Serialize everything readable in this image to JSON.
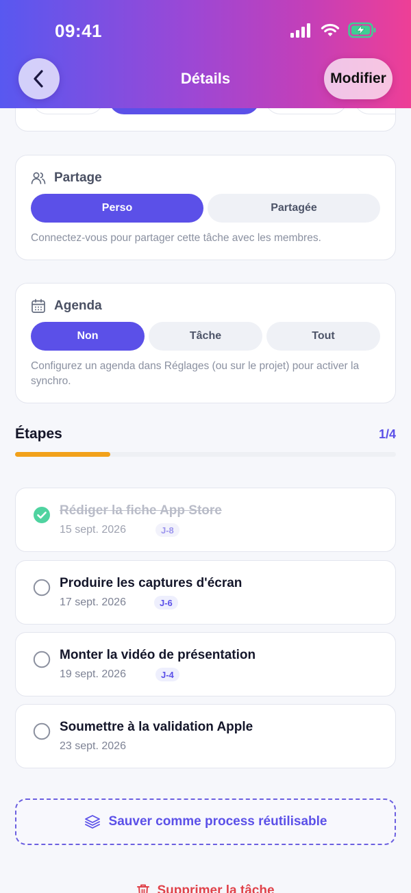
{
  "status_bar": {
    "time": "09:41"
  },
  "header": {
    "title": "Détails",
    "back_icon": "chevron-left-icon",
    "edit_label": "Modifier"
  },
  "sharing": {
    "title": "Partage",
    "options": [
      "Perso",
      "Partagée"
    ],
    "selected": "Perso",
    "hint": "Connectez-vous pour partager cette tâche avec les membres."
  },
  "calendar": {
    "title": "Agenda",
    "options": [
      "Non",
      "Tâche",
      "Tout"
    ],
    "selected": "Non",
    "hint": "Configurez un agenda dans Réglages (ou sur le projet) pour activer la synchro."
  },
  "steps": {
    "title": "Étapes",
    "count": "1/4",
    "progress": 0.25,
    "items": [
      {
        "title": "Rédiger la fiche App Store",
        "date": "15 sept. 2026",
        "badge": "J-8",
        "done": true
      },
      {
        "title": "Produire les captures d'écran",
        "date": "17 sept. 2026",
        "badge": "J-6",
        "done": false
      },
      {
        "title": "Monter la vidéo de présentation",
        "date": "19 sept. 2026",
        "badge": "J-4",
        "done": false
      },
      {
        "title": "Soumettre à la validation Apple",
        "date": "23 sept. 2026",
        "badge": "",
        "done": false
      }
    ]
  },
  "actions": {
    "save_process": "Sauver comme process réutilisable",
    "delete": "Supprimer la tâche"
  },
  "colors": {
    "accent": "#5b50e8",
    "progress": "#f2a11a",
    "success": "#3fcf94",
    "danger": "#e0424a"
  }
}
